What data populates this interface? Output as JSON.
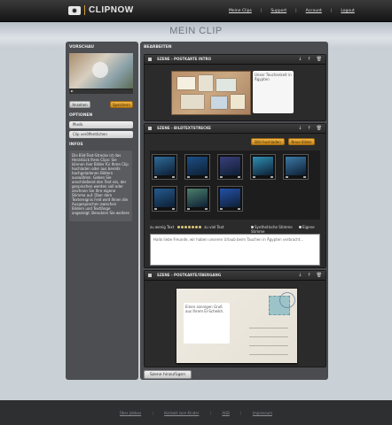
{
  "header": {
    "logo_text": "CLIPNOW",
    "nav": [
      "Meine Clips",
      "Support",
      "Account",
      "Logout"
    ]
  },
  "page_title": "MEIN CLIP",
  "sidebar": {
    "preview_heading": "VORSCHAU",
    "button_preview": "Ansehen",
    "button_download": "Speichern",
    "options_heading": "OPTIONEN",
    "options": [
      "Musik",
      "Clip veröffentlichen"
    ],
    "info_heading": "INFOS",
    "info_text": "Die Bild-Text-Strecke ist das Herzstück Ihres Clips: Sie können hier Bilder für Ihren Clip hochladen oder aus bereits hochgeladenen Bildern auswählen. Geben Sie anschließend den Text ein, der gesprochen werden soll oder zeichnen Sie Ihre eigene Stimme auf. Über dem Textereignis Feld wird Ihnen die Ausgesprochen zwischen Bildern und Textlänge angezeigt. Benutzen Sie weitere"
  },
  "main": {
    "heading": "BEARBEITEN",
    "scenes": [
      {
        "title": "SZENE - POSTKARTE INTRO",
        "text_card": "Unser Teuchenkeit in Ägypten"
      },
      {
        "title": "SZENE - BILDTEXTSTRECKE",
        "button_upload": "Bild hochladen",
        "button_select": "Neue Bilder",
        "thumb_colors": [
          "#2d6b9a",
          "#1d4f86",
          "#3a3f7a",
          "#2f8fb3",
          "#3c7aa6",
          "#255b8f",
          "#4c7f6c",
          "#2451a8"
        ],
        "speed_left": "zu wenig Text",
        "speed_right": "zu viel Text",
        "voice_options": [
          "Synthetische Stimme",
          "Eigene Stimme"
        ],
        "text": "Hallo liebe Freunde, wir haben unseren Urlaub beim Tauchen in Ägypten verbracht..."
      },
      {
        "title": "SZENE - POSTKARTE/ÜBERGANG",
        "postcard_text": "Einen sonnigen Gruß aus Ihrem El-Scheikh."
      }
    ],
    "add_scene_label": "Szene hinzufügen"
  },
  "footer": {
    "links": [
      "Über Jobbox",
      "Kontakt zum Kinder",
      "AGB",
      "Impressum"
    ]
  },
  "colors": {
    "accent": "#d9a23a",
    "panel": "#4a4c50"
  }
}
